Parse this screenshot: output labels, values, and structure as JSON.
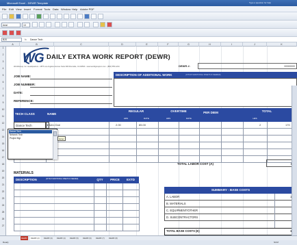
{
  "window": {
    "title": "Microsoft Excel - DEWR Template",
    "title_right": "Type a question for help"
  },
  "menu": [
    "File",
    "Edit",
    "View",
    "Insert",
    "Format",
    "Tools",
    "Data",
    "Window",
    "Help",
    "Adobe PDF"
  ],
  "formula_bar": {
    "name_box": "B20",
    "fx": "fx",
    "value": "Dance Tech"
  },
  "toolbar": {
    "font": "Arial",
    "size": "10"
  },
  "columns": [
    "A",
    "B",
    "C",
    "D",
    "E",
    "F",
    "G",
    "H",
    "I",
    "J",
    "K"
  ],
  "rows": [
    "1",
    "2",
    "3",
    "4",
    "5",
    "6",
    "7",
    "8",
    "9",
    "10",
    "11",
    "12",
    "13",
    "14",
    "15",
    "16",
    "17",
    "18",
    "19",
    "20",
    "21",
    "22",
    "23",
    "24",
    "25",
    "26",
    "27"
  ],
  "report": {
    "logo": "WG",
    "title": "DAILY EXTRA WORK REPORT (DEWR)",
    "company_line": "WorldGroup, Inc. Headquarters - 1875 Los Angeles Avenue Suite 300 Riverside, CA 92503 - www.worldgroupinc.com - (800) 555-1234",
    "dewr_label": "DEWR #:",
    "dewr_value": "00000000",
    "job_name": "JOB NAME:",
    "job_number": "JOB NUMBER:",
    "date": "DATE:",
    "reference": "REFERENCE:",
    "desc_title": "DESCRIPTION OF ADDITIONAL WORK",
    "desc_sub": "(ATTACH ADDITIONAL SHEETS IF NEEDED)"
  },
  "labor": {
    "col_tech_class": "TECH CLASS",
    "col_name": "NAME",
    "col_regular": "REGULAR",
    "col_overtime": "OVERTIME",
    "col_per_diem": "PER DIEM",
    "col_total": "TOTAL",
    "sub_hrs": "HRS",
    "sub_rate": "RATE",
    "row": {
      "tech_class": "Dance Tech",
      "name": "John Doe",
      "reg_hrs": "2.00",
      "reg_rate": "85.00",
      "total_hrs": "2",
      "total": "170"
    },
    "dropdown_options": [
      "Dance Tech",
      "Network Tech",
      "Project Mgr"
    ],
    "tooltip": "Enter",
    "total_label": "TOTAL LABOR COST (A)",
    "total_value": "170"
  },
  "materials": {
    "label": "MATERIALS",
    "col_description": "DESCRIPTION",
    "col_description_sub": "(ATTACH ADDITIONAL SHEETS IF NEEDED)",
    "col_qty": "QTY",
    "col_price": "PRICE",
    "col_extd": "EXTD"
  },
  "summary": {
    "title": "SUMMARY - BASE COSTS",
    "items": [
      {
        "label": "A.  LABOR",
        "value": "170"
      },
      {
        "label": "B.  MATERIALS",
        "value": ""
      },
      {
        "label": "C.  EQUIPMENT/OTHER",
        "value": ""
      },
      {
        "label": "D.  SUBCONTRACTORS",
        "value": ""
      }
    ],
    "total_label": "TOTAL BASE COSTS (E)",
    "total_value": "170"
  },
  "sheet_tabs": [
    "DEWR",
    "DEWR (2)",
    "DEWR (3)",
    "DEWR (4)",
    "DEWR (5)",
    "DEWR (6)",
    "DEWR (7)",
    "DEWR (8)"
  ],
  "status": {
    "text": "Ready",
    "zoom": "NUM"
  },
  "colors": {
    "header_blue": "#2b4aa1",
    "titlebar": "#3d6fb6"
  }
}
